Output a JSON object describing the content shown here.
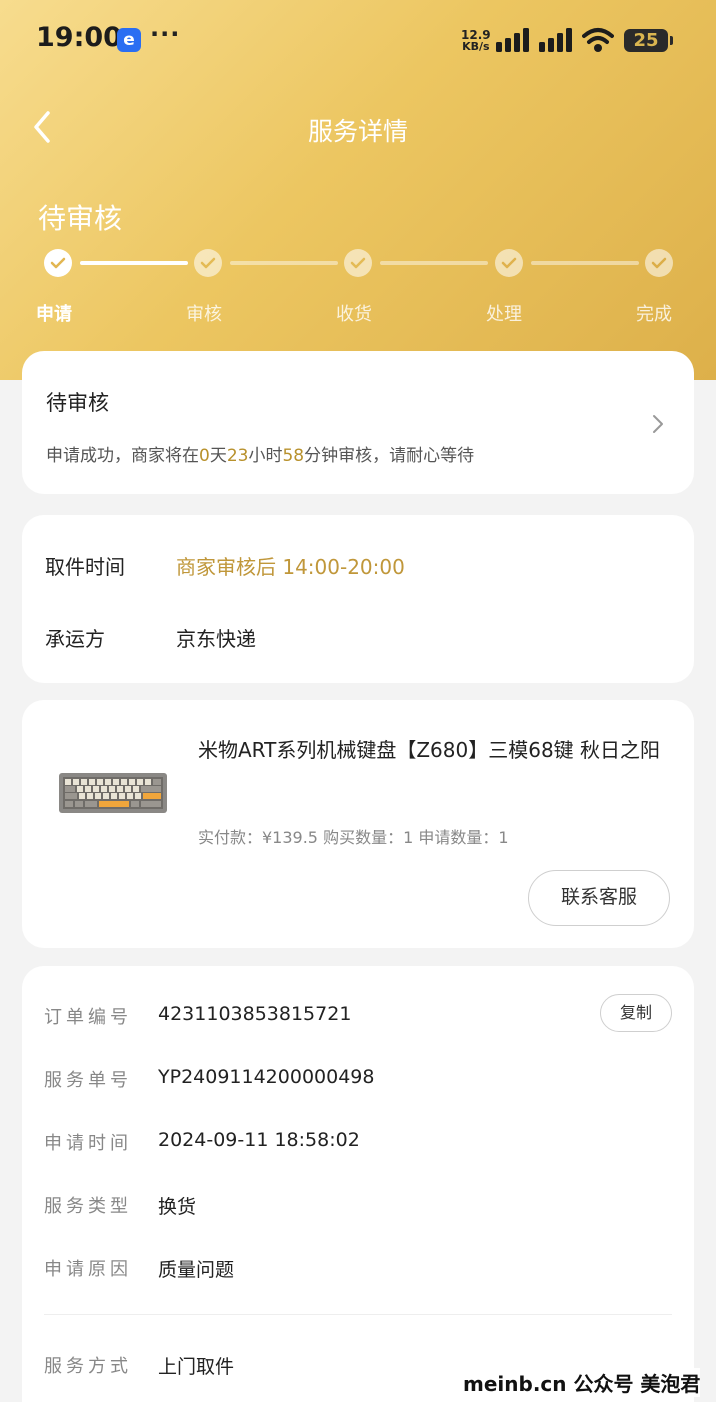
{
  "status_bar": {
    "time": "19:00",
    "app_badge": "e",
    "more": "···",
    "speed_value": "12.9",
    "speed_unit": "KB/s",
    "battery": "25"
  },
  "nav": {
    "title": "服务详情"
  },
  "header": {
    "status": "待审核"
  },
  "progress": {
    "steps": [
      "申请",
      "审核",
      "收货",
      "处理",
      "完成"
    ],
    "current_step": 1
  },
  "review_card": {
    "title": "待审核",
    "desc_prefix": "申请成功，商家将在",
    "days": "0",
    "days_unit": "天",
    "hours": "23",
    "hours_unit": "小时",
    "minutes": "58",
    "desc_suffix": "分钟审核，请耐心等待"
  },
  "pickup_card": {
    "time_label": "取件时间",
    "time_value": "商家审核后 14:00-20:00",
    "carrier_label": "承运方",
    "carrier_value": "京东快递"
  },
  "product_card": {
    "name": "米物ART系列机械键盘【Z680】三模68键 秋日之阳",
    "meta": "实付款：¥139.5  购买数量：1  申请数量：1",
    "contact_button": "联系客服"
  },
  "info_card": {
    "copy_button": "复制",
    "rows": [
      {
        "label": "订单编号",
        "value": "4231103853815721"
      },
      {
        "label": "服务单号",
        "value": "YP2409114200000498"
      },
      {
        "label": "申请时间",
        "value": "2024-09-11 18:58:02"
      },
      {
        "label": "服务类型",
        "value": "换货"
      },
      {
        "label": "申请原因",
        "value": "质量问题"
      },
      {
        "label": "服务方式",
        "value": "上门取件"
      }
    ]
  },
  "watermark": "meinb.cn 公众号 美泡君",
  "colors": {
    "accent_gold": "#c0973a",
    "hero_gradient_start": "#f7dc8e",
    "hero_gradient_end": "#ddb04a"
  }
}
